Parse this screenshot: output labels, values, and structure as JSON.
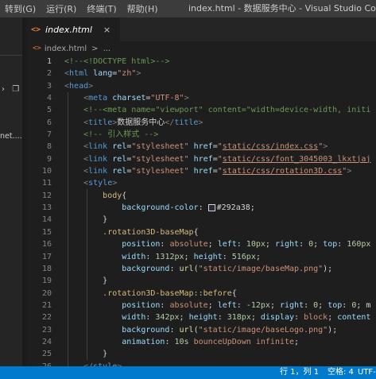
{
  "menu": {
    "items": [
      "转到(G)",
      "运行(R)",
      "终端(T)",
      "帮助(H)"
    ]
  },
  "window": {
    "title": "index.html - 数据服务中心 - Visual Studio Code"
  },
  "sidebar": {
    "partial_text": "net...."
  },
  "tab": {
    "icon": "<>",
    "label": "index.html",
    "close": "×"
  },
  "breadcrumb": {
    "icon": "<>",
    "file": "index.html",
    "separator": ">",
    "more": "..."
  },
  "editor": {
    "line_numbers": [
      "1",
      "2",
      "3",
      "4",
      "5",
      "6",
      "7",
      "8",
      "9",
      "10",
      "11",
      "12",
      "13",
      "14",
      "15",
      "16",
      "17",
      "18",
      "19",
      "20",
      "21",
      "22",
      "23",
      "24",
      "25",
      "26"
    ],
    "active_line": 1,
    "lines": [
      [
        [
          "c",
          "<!--<!DOCTYPE html>-->"
        ]
      ],
      [
        [
          "br",
          "<"
        ],
        [
          "tag",
          "html"
        ],
        [
          "t",
          " "
        ],
        [
          "attr",
          "lang"
        ],
        [
          "t",
          "="
        ],
        [
          "str",
          "\"zh\""
        ],
        [
          "br",
          ">"
        ]
      ],
      [
        [
          "br",
          "<"
        ],
        [
          "tag",
          "head"
        ],
        [
          "br",
          ">"
        ]
      ],
      [
        [
          "t",
          "    "
        ],
        [
          "br",
          "<"
        ],
        [
          "tag",
          "meta"
        ],
        [
          "t",
          " "
        ],
        [
          "attr",
          "charset"
        ],
        [
          "t",
          "="
        ],
        [
          "str",
          "\"UTF-8\""
        ],
        [
          "br",
          ">"
        ]
      ],
      [
        [
          "t",
          "    "
        ],
        [
          "c",
          "<!--<meta name=\"viewport\" content=\"width=device-width, initi"
        ]
      ],
      [
        [
          "t",
          "    "
        ],
        [
          "br",
          "<"
        ],
        [
          "tag",
          "title"
        ],
        [
          "br",
          ">"
        ],
        [
          "t",
          "数据服务中心"
        ],
        [
          "br",
          "</"
        ],
        [
          "tag",
          "title"
        ],
        [
          "br",
          ">"
        ]
      ],
      [
        [
          "t",
          "    "
        ],
        [
          "c",
          "<!-- 引入样式 -->"
        ]
      ],
      [
        [
          "t",
          "    "
        ],
        [
          "br",
          "<"
        ],
        [
          "tag",
          "link"
        ],
        [
          "t",
          " "
        ],
        [
          "attr",
          "rel"
        ],
        [
          "t",
          "="
        ],
        [
          "str",
          "\"stylesheet\""
        ],
        [
          "t",
          " "
        ],
        [
          "attr",
          "href"
        ],
        [
          "t",
          "="
        ],
        [
          "str",
          "\""
        ],
        [
          "lnk",
          "static/css/index.css"
        ],
        [
          "str",
          "\""
        ],
        [
          "br",
          ">"
        ]
      ],
      [
        [
          "t",
          "    "
        ],
        [
          "br",
          "<"
        ],
        [
          "tag",
          "link"
        ],
        [
          "t",
          " "
        ],
        [
          "attr",
          "rel"
        ],
        [
          "t",
          "="
        ],
        [
          "str",
          "\"stylesheet\""
        ],
        [
          "t",
          " "
        ],
        [
          "attr",
          "href"
        ],
        [
          "t",
          "="
        ],
        [
          "str",
          "\""
        ],
        [
          "lnk",
          "static/css/font_3045003_lkxtjaj"
        ]
      ],
      [
        [
          "t",
          "    "
        ],
        [
          "br",
          "<"
        ],
        [
          "tag",
          "link"
        ],
        [
          "t",
          " "
        ],
        [
          "attr",
          "rel"
        ],
        [
          "t",
          "="
        ],
        [
          "str",
          "\"stylesheet\""
        ],
        [
          "t",
          " "
        ],
        [
          "attr",
          "href"
        ],
        [
          "t",
          "="
        ],
        [
          "str",
          "\""
        ],
        [
          "lnk",
          "static/css/rotation3D.css"
        ],
        [
          "str",
          "\""
        ],
        [
          "br",
          ">"
        ]
      ],
      [
        [
          "t",
          "    "
        ],
        [
          "br",
          "<"
        ],
        [
          "tag",
          "style"
        ],
        [
          "br",
          ">"
        ]
      ],
      [
        [
          "t",
          "        "
        ],
        [
          "sel",
          "body"
        ],
        [
          "t",
          "{"
        ]
      ],
      [
        [
          "t",
          "            "
        ],
        [
          "prop",
          "background-color"
        ],
        [
          "t",
          ": "
        ],
        [
          "sw",
          ""
        ],
        [
          "t",
          "#292a38;"
        ]
      ],
      [
        [
          "t",
          "        "
        ],
        [
          "t",
          "}"
        ]
      ],
      [
        [
          "t",
          "        "
        ],
        [
          "sel",
          ".rotation3D-baseMap"
        ],
        [
          "t",
          "{"
        ]
      ],
      [
        [
          "t",
          "            "
        ],
        [
          "prop",
          "position"
        ],
        [
          "t",
          ": "
        ],
        [
          "str",
          "absolute"
        ],
        [
          "t",
          "; "
        ],
        [
          "prop",
          "left"
        ],
        [
          "t",
          ": "
        ],
        [
          "num",
          "10px"
        ],
        [
          "t",
          "; "
        ],
        [
          "prop",
          "right"
        ],
        [
          "t",
          ": "
        ],
        [
          "num",
          "0"
        ],
        [
          "t",
          "; "
        ],
        [
          "prop",
          "top"
        ],
        [
          "t",
          ": "
        ],
        [
          "num",
          "160px"
        ]
      ],
      [
        [
          "t",
          "            "
        ],
        [
          "prop",
          "width"
        ],
        [
          "t",
          ": "
        ],
        [
          "num",
          "1312px"
        ],
        [
          "t",
          "; "
        ],
        [
          "prop",
          "height"
        ],
        [
          "t",
          ": "
        ],
        [
          "num",
          "516px"
        ],
        [
          "t",
          ";"
        ]
      ],
      [
        [
          "t",
          "            "
        ],
        [
          "prop",
          "background"
        ],
        [
          "t",
          ": "
        ],
        [
          "fn",
          "url"
        ],
        [
          "t",
          "("
        ],
        [
          "str",
          "\"static/image/baseMap.png\""
        ],
        [
          "t",
          ");"
        ]
      ],
      [
        [
          "t",
          "        "
        ],
        [
          "t",
          "}"
        ]
      ],
      [
        [
          "t",
          "        "
        ],
        [
          "sel",
          ".rotation3D-baseMap::before"
        ],
        [
          "t",
          "{"
        ]
      ],
      [
        [
          "t",
          "            "
        ],
        [
          "prop",
          "position"
        ],
        [
          "t",
          ": "
        ],
        [
          "str",
          "absolute"
        ],
        [
          "t",
          "; "
        ],
        [
          "prop",
          "left"
        ],
        [
          "t",
          ": "
        ],
        [
          "num",
          "-12px"
        ],
        [
          "t",
          "; "
        ],
        [
          "prop",
          "right"
        ],
        [
          "t",
          ": "
        ],
        [
          "num",
          "0"
        ],
        [
          "t",
          "; "
        ],
        [
          "prop",
          "top"
        ],
        [
          "t",
          ": "
        ],
        [
          "num",
          "0"
        ],
        [
          "t",
          "; m"
        ]
      ],
      [
        [
          "t",
          "            "
        ],
        [
          "prop",
          "width"
        ],
        [
          "t",
          ": "
        ],
        [
          "num",
          "342px"
        ],
        [
          "t",
          "; "
        ],
        [
          "prop",
          "height"
        ],
        [
          "t",
          ": "
        ],
        [
          "num",
          "318px"
        ],
        [
          "t",
          "; "
        ],
        [
          "prop",
          "display"
        ],
        [
          "t",
          ": "
        ],
        [
          "str",
          "block"
        ],
        [
          "t",
          "; "
        ],
        [
          "prop",
          "content"
        ]
      ],
      [
        [
          "t",
          "            "
        ],
        [
          "prop",
          "background"
        ],
        [
          "t",
          ": "
        ],
        [
          "fn",
          "url"
        ],
        [
          "t",
          "("
        ],
        [
          "str",
          "\"static/image/baseLogo.png\""
        ],
        [
          "t",
          ");"
        ]
      ],
      [
        [
          "t",
          "            "
        ],
        [
          "prop",
          "animation"
        ],
        [
          "t",
          ": "
        ],
        [
          "num",
          "10s"
        ],
        [
          "t",
          " "
        ],
        [
          "str",
          "bounceUpDown"
        ],
        [
          "t",
          " "
        ],
        [
          "str",
          "infinite"
        ],
        [
          "t",
          ";"
        ]
      ],
      [
        [
          "t",
          "        "
        ],
        [
          "t",
          "}"
        ]
      ],
      [
        [
          "t",
          "    "
        ],
        [
          "br",
          "</"
        ],
        [
          "tag",
          "style"
        ],
        [
          "br",
          ">"
        ]
      ]
    ]
  },
  "status": {
    "position": "行 1，列 1",
    "spaces": "空格: 4",
    "encoding": "UTF-"
  },
  "colors": {
    "statusbar": "#007acc",
    "editor_bg": "#1e1e1e",
    "titlebar": "#3c3c3c"
  },
  "icons": {
    "sidebar": [
      "chevron-right-icon",
      "copy-icon"
    ]
  }
}
